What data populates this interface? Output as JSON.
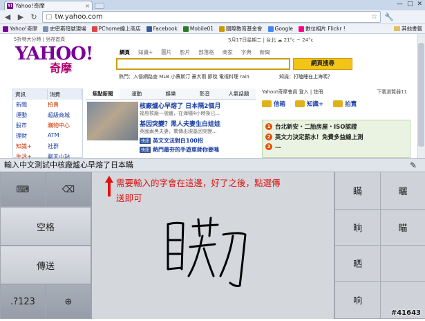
{
  "browser": {
    "tab_title": "Yahoo!奇摩",
    "tab_close": "×",
    "url": "tw.yahoo.com",
    "window_controls": [
      "—",
      "□",
      "✕"
    ],
    "bookmarks": [
      "Yahoo!奇摩",
      "史密斯暗號現場",
      "PChome線上商店",
      "Facebook",
      "Mobile01",
      "國際教育基金會",
      "Google",
      "數位相片 Flickr !"
    ],
    "other_bookmarks": "其他書籤"
  },
  "yahoo": {
    "topline": "5折特大分時 | 另存首頁",
    "date": "5月17日星期二 | 台北 ☁ 21°c ~ 24°c",
    "logo_text": "YAHOO!",
    "logo_sub": "奇摩",
    "search_tabs": [
      "網頁",
      "知識+",
      "圖片",
      "影片",
      "部落格",
      "商家",
      "字典",
      "新聞"
    ],
    "search_button": "網頁搜尋",
    "hot_keywords": "熱門：入侵網路查 MLB 小賈斯汀 豪大雨 節稅 電視料理 rain",
    "knowledge_line": "知識：打瞌睡在上海嗎？",
    "categories": {
      "tabs": [
        "資訊",
        "消費"
      ],
      "items": [
        "新聞",
        "拍賣",
        "運動",
        "超級商城",
        "股市",
        "購物中心",
        "理財",
        "ATM",
        "知識+",
        "社群",
        "生活+",
        "聊天小站"
      ]
    },
    "news": {
      "tabs": [
        "焦點新聞",
        "運動",
        "娛樂",
        "影音",
        "人氣話題"
      ],
      "headline1": "核廠爐心早熔了 日本隔2個月",
      "desc1": "福島核廠一號爐，在海嘯4小時後已...",
      "headline2": "基因突變？黑人夫妻生白娃娃",
      "desc2": "英國兩黑夫妻，驚傳出現基因突變...",
      "item3_tag": "快訊",
      "item3": "英文文法對白100招",
      "item4_tag": "快訊",
      "item4": "熱門最夯的手遊車師你要嗎"
    },
    "member": {
      "title": "Yahoo!奇摩會員 登入 | 註冊",
      "mail": "信箱",
      "knowledge": "知識+",
      "auction": "拍賣",
      "download": "下載瀏覽器11"
    },
    "promos": [
      {
        "num": "1",
        "text": "台北新安・二胎房屋・ISO認證"
      },
      {
        "num": "2",
        "text": "英文力決定薪水！免費多益線上測"
      },
      {
        "num": "3",
        "text": "…"
      }
    ]
  },
  "composition": {
    "text": "輸入中文測試中核廠爐心早熔了日本瞞"
  },
  "keyboard": {
    "space": "空格",
    "send": "傳送",
    "numbers": ".?123",
    "keyboard_icon": "⌨",
    "backspace_icon": "⌫",
    "globe_icon": "⊕",
    "candidates": [
      "瞞",
      "曬",
      "晌",
      "瞄",
      "晒",
      "",
      "响",
      ""
    ]
  },
  "annotation": {
    "note": "需要輸入的字會在這邊，好了之後，點選傳送即可"
  },
  "watermark": "#41643"
}
